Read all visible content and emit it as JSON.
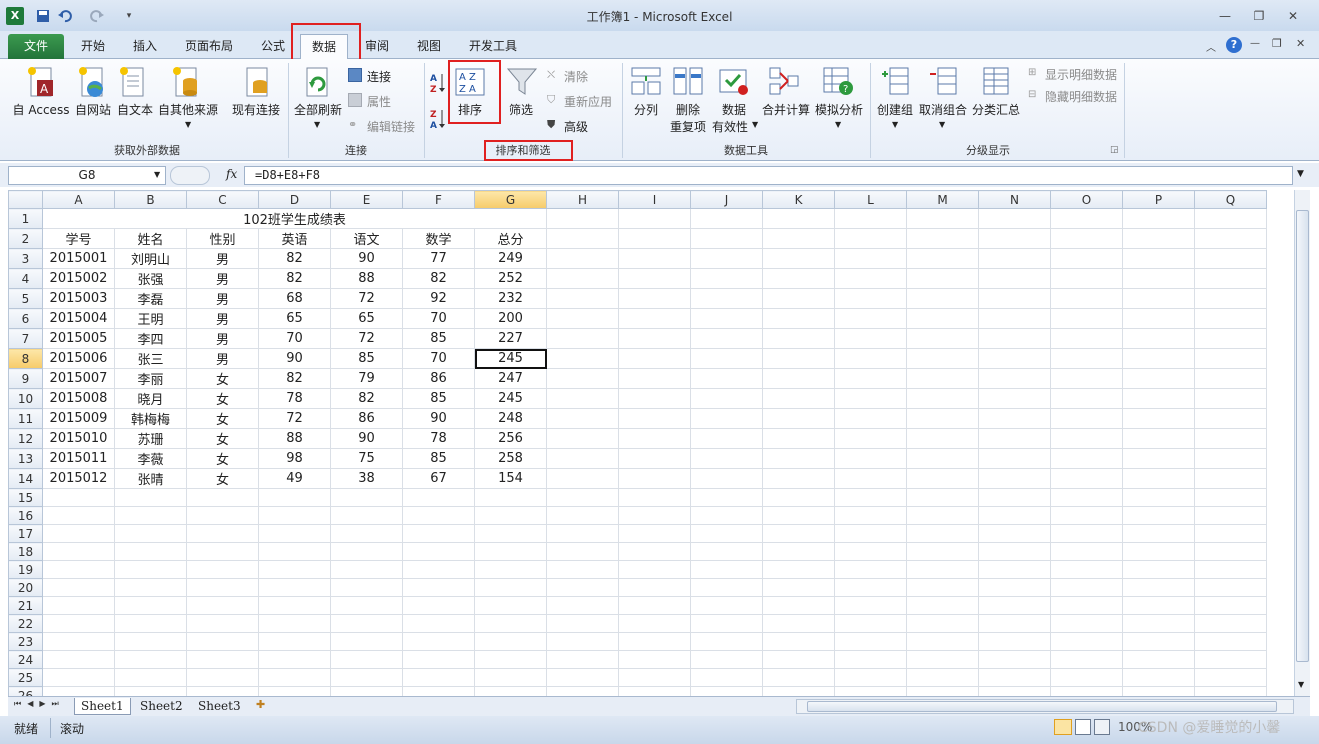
{
  "window": {
    "title": "工作簿1 - Microsoft Excel"
  },
  "tabs": [
    {
      "label": "文件"
    },
    {
      "label": "开始"
    },
    {
      "label": "插入"
    },
    {
      "label": "页面布局"
    },
    {
      "label": "公式"
    },
    {
      "label": "数据"
    },
    {
      "label": "审阅"
    },
    {
      "label": "视图"
    },
    {
      "label": "开发工具"
    }
  ],
  "ribbon": {
    "get_external": {
      "label": "获取外部数据",
      "access": "自 Access",
      "web": "自网站",
      "text": "自文本",
      "other": "自其他来源",
      "existing": "现有连接"
    },
    "connections": {
      "label": "连接",
      "refresh_all": "全部刷新",
      "connections": "连接",
      "properties": "属性",
      "edit_links": "编辑链接"
    },
    "sort_filter": {
      "label": "排序和筛选",
      "sort": "排序",
      "filter": "筛选",
      "clear": "清除",
      "reapply": "重新应用",
      "advanced": "高级"
    },
    "data_tools": {
      "label": "数据工具",
      "text_to_columns": "分列",
      "remove_dup_1": "删除",
      "remove_dup_2": "重复项",
      "validation_1": "数据",
      "validation_2": "有效性",
      "consolidate": "合并计算",
      "what_if": "模拟分析"
    },
    "outline": {
      "label": "分级显示",
      "group": "创建组",
      "ungroup": "取消组合",
      "subtotal": "分类汇总",
      "show_detail": "显示明细数据",
      "hide_detail": "隐藏明细数据"
    }
  },
  "formula_bar": {
    "name_box": "G8",
    "fx": "fx",
    "formula": "=D8+E8+F8"
  },
  "sheet": {
    "columns": [
      "A",
      "B",
      "C",
      "D",
      "E",
      "F",
      "G",
      "H",
      "I",
      "J",
      "K",
      "L",
      "M",
      "N",
      "O",
      "P",
      "Q"
    ],
    "title": "102班学生成绩表",
    "headers": [
      "学号",
      "姓名",
      "性别",
      "英语",
      "语文",
      "数学",
      "总分"
    ],
    "rows": [
      [
        "2015001",
        "刘明山",
        "男",
        "82",
        "90",
        "77",
        "249"
      ],
      [
        "2015002",
        "张强",
        "男",
        "82",
        "88",
        "82",
        "252"
      ],
      [
        "2015003",
        "李磊",
        "男",
        "68",
        "72",
        "92",
        "232"
      ],
      [
        "2015004",
        "王明",
        "男",
        "65",
        "65",
        "70",
        "200"
      ],
      [
        "2015005",
        "李四",
        "男",
        "70",
        "72",
        "85",
        "227"
      ],
      [
        "2015006",
        "张三",
        "男",
        "90",
        "85",
        "70",
        "245"
      ],
      [
        "2015007",
        "李丽",
        "女",
        "82",
        "79",
        "86",
        "247"
      ],
      [
        "2015008",
        "晓月",
        "女",
        "78",
        "82",
        "85",
        "245"
      ],
      [
        "2015009",
        "韩梅梅",
        "女",
        "72",
        "86",
        "90",
        "248"
      ],
      [
        "2015010",
        "苏珊",
        "女",
        "88",
        "90",
        "78",
        "256"
      ],
      [
        "2015011",
        "李薇",
        "女",
        "98",
        "75",
        "85",
        "258"
      ],
      [
        "2015012",
        "张晴",
        "女",
        "49",
        "38",
        "67",
        "154"
      ]
    ],
    "row_count": 27
  },
  "sheet_tabs": [
    "Sheet1",
    "Sheet2",
    "Sheet3"
  ],
  "status": {
    "ready": "就绪",
    "scroll": "滚动",
    "zoom": "100%",
    "watermark": "CSDN @爱睡觉的小馨"
  }
}
